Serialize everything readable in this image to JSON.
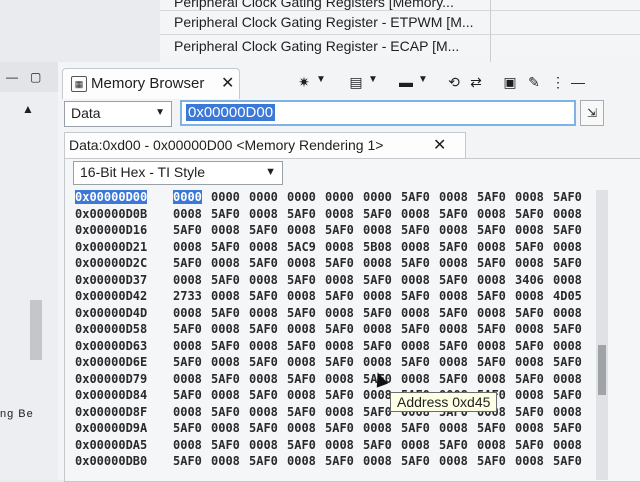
{
  "registers": [
    "Peripheral Clock Gating Registers [Memory...",
    "Peripheral Clock Gating Register - ETPWM [M...",
    "Peripheral Clock Gating Register - ECAP [M..."
  ],
  "left_panel": {
    "label": "ng  Be"
  },
  "view": {
    "tab_label": "Memory Browser",
    "address_space": "Data",
    "address_value": "0x00000D00",
    "rendering_tab": "Data:0xd00 - 0x00000D00 <Memory Rendering 1>",
    "format": "16-Bit Hex - TI Style",
    "tooltip": "Address 0xd45"
  },
  "memory": [
    {
      "addr": "0x00000D00",
      "cells": [
        "0000",
        "0000",
        "0000",
        "0000",
        "0000",
        "0000",
        "5AF0",
        "0008",
        "5AF0",
        "0008",
        "5AF0"
      ]
    },
    {
      "addr": "0x00000D0B",
      "cells": [
        "0008",
        "5AF0",
        "0008",
        "5AF0",
        "0008",
        "5AF0",
        "0008",
        "5AF0",
        "0008",
        "5AF0",
        "0008"
      ]
    },
    {
      "addr": "0x00000D16",
      "cells": [
        "5AF0",
        "0008",
        "5AF0",
        "0008",
        "5AF0",
        "0008",
        "5AF0",
        "0008",
        "5AF0",
        "0008",
        "5AF0"
      ]
    },
    {
      "addr": "0x00000D21",
      "cells": [
        "0008",
        "5AF0",
        "0008",
        "5AC9",
        "0008",
        "5B08",
        "0008",
        "5AF0",
        "0008",
        "5AF0",
        "0008"
      ]
    },
    {
      "addr": "0x00000D2C",
      "cells": [
        "5AF0",
        "0008",
        "5AF0",
        "0008",
        "5AF0",
        "0008",
        "5AF0",
        "0008",
        "5AF0",
        "0008",
        "5AF0"
      ]
    },
    {
      "addr": "0x00000D37",
      "cells": [
        "0008",
        "5AF0",
        "0008",
        "5AF0",
        "0008",
        "5AF0",
        "0008",
        "5AF0",
        "0008",
        "3406",
        "0008"
      ]
    },
    {
      "addr": "0x00000D42",
      "cells": [
        "2733",
        "0008",
        "5AF0",
        "0008",
        "5AF0",
        "0008",
        "5AF0",
        "0008",
        "5AF0",
        "0008",
        "4D05"
      ]
    },
    {
      "addr": "0x00000D4D",
      "cells": [
        "0008",
        "5AF0",
        "0008",
        "5AF0",
        "0008",
        "5AF0",
        "0008",
        "5AF0",
        "0008",
        "5AF0",
        "0008"
      ]
    },
    {
      "addr": "0x00000D58",
      "cells": [
        "5AF0",
        "0008",
        "5AF0",
        "0008",
        "5AF0",
        "0008",
        "5AF0",
        "0008",
        "5AF0",
        "0008",
        "5AF0"
      ]
    },
    {
      "addr": "0x00000D63",
      "cells": [
        "0008",
        "5AF0",
        "0008",
        "5AF0",
        "0008",
        "5AF0",
        "0008",
        "5AF0",
        "0008",
        "5AF0",
        "0008"
      ]
    },
    {
      "addr": "0x00000D6E",
      "cells": [
        "5AF0",
        "0008",
        "5AF0",
        "0008",
        "5AF0",
        "0008",
        "5AF0",
        "0008",
        "5AF0",
        "0008",
        "5AF0"
      ]
    },
    {
      "addr": "0x00000D79",
      "cells": [
        "0008",
        "5AF0",
        "0008",
        "5AF0",
        "0008",
        "5AF0",
        "0008",
        "5AF0",
        "0008",
        "5AF0",
        "0008"
      ]
    },
    {
      "addr": "0x00000D84",
      "cells": [
        "5AF0",
        "0008",
        "5AF0",
        "0008",
        "5AF0",
        "0008",
        "5AF0",
        "0008",
        "5AF0",
        "0008",
        "5AF0"
      ]
    },
    {
      "addr": "0x00000D8F",
      "cells": [
        "0008",
        "5AF0",
        "0008",
        "5AF0",
        "0008",
        "5AF0",
        "0008",
        "5AF0",
        "0008",
        "5AF0",
        "0008"
      ]
    },
    {
      "addr": "0x00000D9A",
      "cells": [
        "5AF0",
        "0008",
        "5AF0",
        "0008",
        "5AF0",
        "0008",
        "5AF0",
        "0008",
        "5AF0",
        "0008",
        "5AF0"
      ]
    },
    {
      "addr": "0x00000DA5",
      "cells": [
        "0008",
        "5AF0",
        "0008",
        "5AF0",
        "0008",
        "5AF0",
        "0008",
        "5AF0",
        "0008",
        "5AF0",
        "0008"
      ]
    },
    {
      "addr": "0x00000DB0",
      "cells": [
        "5AF0",
        "0008",
        "5AF0",
        "0008",
        "5AF0",
        "0008",
        "5AF0",
        "0008",
        "5AF0",
        "0008",
        "5AF0"
      ]
    }
  ]
}
